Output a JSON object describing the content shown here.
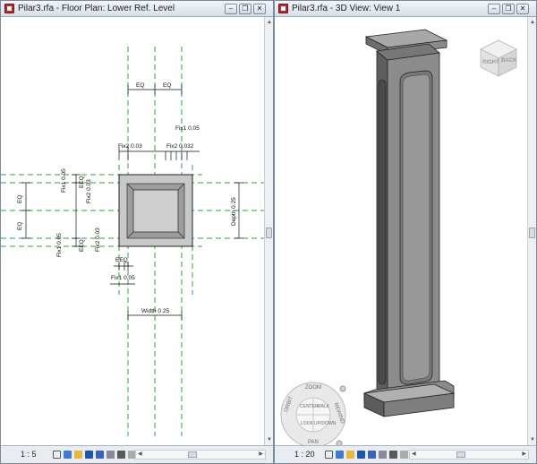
{
  "left_window": {
    "title": "Pilar3.rfa - Floor Plan: Lower Ref. Level",
    "scale": "1 : 5",
    "dimensions": {
      "eq_top_left": "EQ",
      "eq_top_right": "EQ",
      "fix1_top": "Fix1 0.05",
      "fix2_left_top": "Fix2 0.03",
      "fix2_right_top": "Fix2 0.032",
      "eq_left_upper": "EQ",
      "eq_left_lower": "EQ",
      "fix1_left_upper": "Fix1 0.05",
      "e_eq_upper": "EEQ",
      "fix2_left_upper": "Fix2 0.03",
      "fix1_left_lower": "Fix1 0.05",
      "e_eq_lower": "EEQ",
      "fix2_left_lower": "Fix2 0.03",
      "e_eq_bottom": "EEQ",
      "fix1_bottom": "Fix1 0.05",
      "depth": "Depth 0.25",
      "width": "Width 0.25"
    }
  },
  "right_window": {
    "title": "Pilar3.rfa - 3D View: View 1",
    "scale": "1 : 20",
    "view_cube": {
      "right_label": "RIGHT",
      "back_label": "BACK"
    },
    "steering_wheel": {
      "zoom": "ZOOM",
      "orbit": "ORBIT",
      "pan": "PAN",
      "rewind": "REWIND",
      "center": "CENTER",
      "walk": "WALK",
      "look": "LOOK",
      "up_down": "UP/DOWN"
    }
  },
  "window_buttons": {
    "minimize": "–",
    "restore": "❐",
    "close": "✕"
  },
  "colors": {
    "reference_plane": "#22aa33",
    "pillar_face": "#8c8c8c",
    "pillar_dark": "#5a5a5a"
  },
  "icons": [
    "revit-family-icon",
    "minimize-icon",
    "restore-icon",
    "close-icon",
    "view-cube-icon",
    "steering-wheel-icon"
  ]
}
